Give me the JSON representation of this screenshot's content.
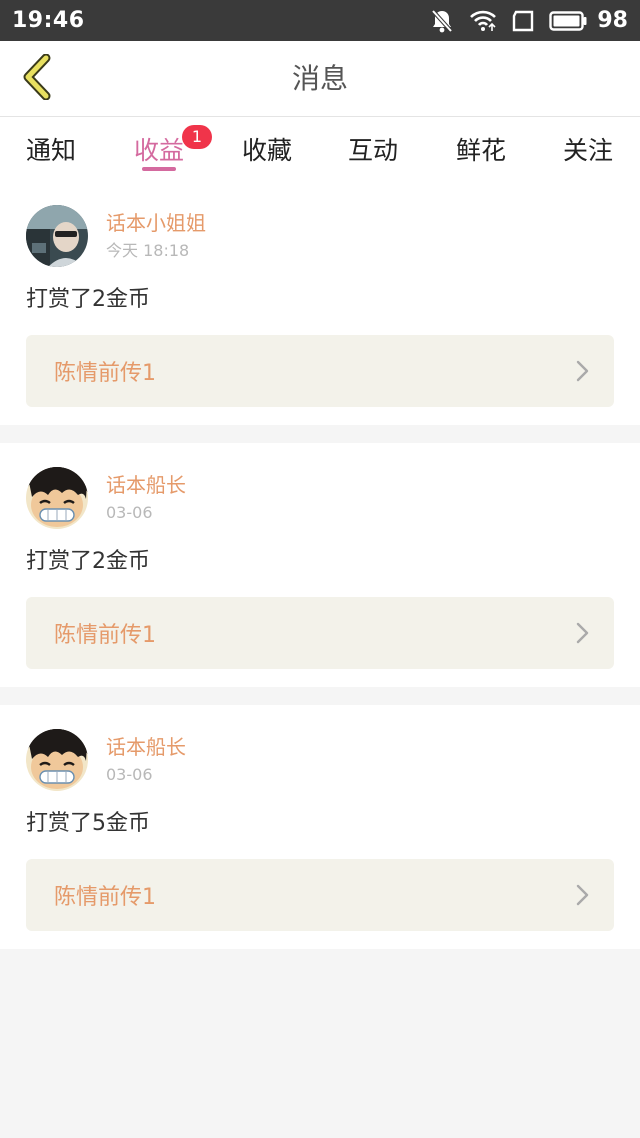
{
  "status_bar": {
    "time": "19:46",
    "battery": "98",
    "icons": [
      "mute-bell-icon",
      "wifi-icon",
      "screen-icon",
      "battery-icon"
    ]
  },
  "header": {
    "title": "消息",
    "back_icon": "chevron-left-icon"
  },
  "tabs": [
    {
      "label": "通知"
    },
    {
      "label": "收益",
      "active": true,
      "badge": "1"
    },
    {
      "label": "收藏"
    },
    {
      "label": "互动"
    },
    {
      "label": "鲜花"
    },
    {
      "label": "关注"
    }
  ],
  "colors": {
    "accent": "#d46a9f",
    "name": "#e59a6a",
    "badge": "#f0344a",
    "link_bg": "#f3f2ea"
  },
  "messages": [
    {
      "user": "话本小姐姐",
      "time": "今天 18:18",
      "text": "打赏了2金币",
      "work": "陈情前传1",
      "avatar": "photo-avatar"
    },
    {
      "user": "话本船长",
      "time": "03-06",
      "text": "打赏了2金币",
      "work": "陈情前传1",
      "avatar": "cartoon-avatar"
    },
    {
      "user": "话本船长",
      "time": "03-06",
      "text": "打赏了5金币",
      "work": "陈情前传1",
      "avatar": "cartoon-avatar"
    }
  ]
}
